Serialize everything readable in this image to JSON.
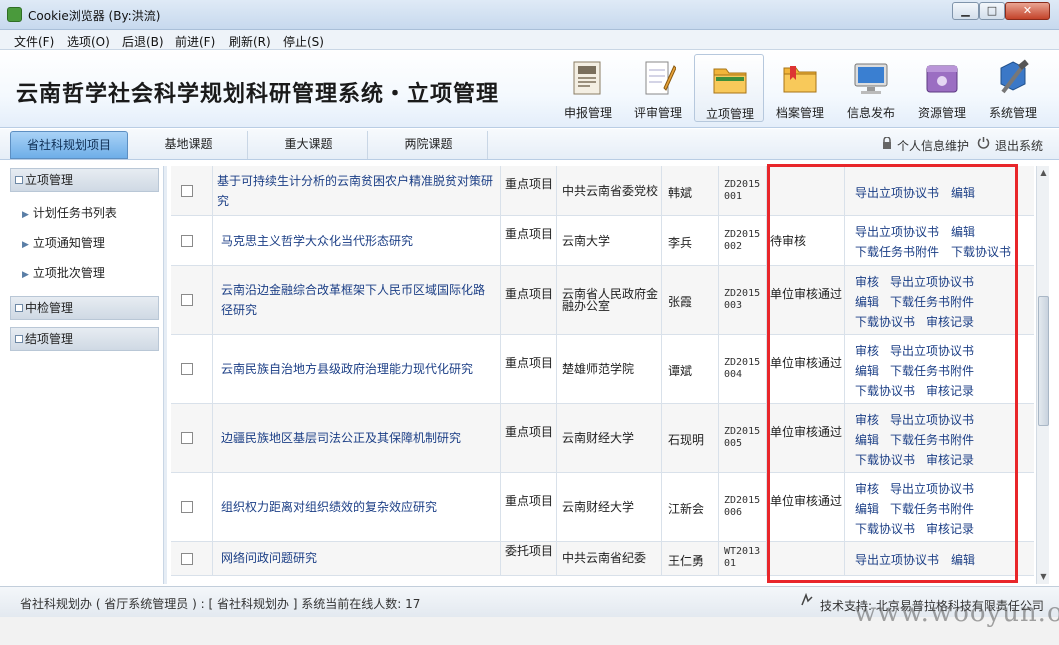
{
  "window": {
    "title": "Cookie浏览器 (By:洪流)",
    "minimize": "▁",
    "maximize": "□",
    "close": "✕"
  },
  "menu": [
    "文件(F)",
    "选项(O)",
    "后退(B)",
    "前进(F)",
    "刷新(R)",
    "停止(S)"
  ],
  "header": {
    "system_title": "云南哲学社会科学规划科研管理系统・立项管理",
    "nav": [
      {
        "label": "申报管理",
        "icon": "newspaper-icon",
        "active": false
      },
      {
        "label": "评审管理",
        "icon": "notepad-pencil-icon",
        "active": false
      },
      {
        "label": "立项管理",
        "icon": "folder-icon",
        "active": true
      },
      {
        "label": "档案管理",
        "icon": "folder-bookmark-icon",
        "active": false
      },
      {
        "label": "信息发布",
        "icon": "monitor-icon",
        "active": false
      },
      {
        "label": "资源管理",
        "icon": "purple-box-icon",
        "active": false
      },
      {
        "label": "系统管理",
        "icon": "tools-icon",
        "active": false
      }
    ]
  },
  "tabs": [
    {
      "label": "省社科规划项目",
      "active": true
    },
    {
      "label": "基地课题",
      "active": false
    },
    {
      "label": "重大课题",
      "active": false
    },
    {
      "label": "两院课题",
      "active": false
    }
  ],
  "user_links": {
    "profile": "个人信息维护",
    "logout": "退出系统"
  },
  "sidebar": {
    "groups": [
      {
        "label": "立项管理",
        "items": [
          "计划任务书列表",
          "立项通知管理",
          "立项批次管理"
        ]
      },
      {
        "label": "中检管理",
        "items": []
      },
      {
        "label": "结项管理",
        "items": []
      }
    ]
  },
  "table": {
    "rows": [
      {
        "title": "基于可持续生计分析的云南贫困农户精准脱贫对策研究",
        "type": "重点项目",
        "org": "中共云南省委党校",
        "person": "韩斌",
        "code": "ZD2015001",
        "status": "",
        "ops": [
          [
            "导出立项协议书",
            "编辑"
          ]
        ]
      },
      {
        "title": "马克思主义哲学大众化当代形态研究",
        "type": "重点项目",
        "org": "云南大学",
        "person": "李兵",
        "code": "ZD2015002",
        "status": "待审核",
        "ops": [
          [
            "导出立项协议书",
            "编辑"
          ],
          [
            "下载任务书附件",
            "下载协议书"
          ]
        ]
      },
      {
        "title": "云南沿边金融综合改革框架下人民币区域国际化路径研究",
        "type": "重点项目",
        "org": "云南省人民政府金融办公室",
        "person": "张霞",
        "code": "ZD2015003",
        "status": "单位审核通过",
        "ops": [
          [
            "审核",
            "导出立项协议书"
          ],
          [
            "编辑",
            "下载任务书附件"
          ],
          [
            "下载协议书",
            "审核记录"
          ]
        ]
      },
      {
        "title": "云南民族自治地方县级政府治理能力现代化研究",
        "type": "重点项目",
        "org": "楚雄师范学院",
        "person": "谭斌",
        "code": "ZD2015004",
        "status": "单位审核通过",
        "ops": [
          [
            "审核",
            "导出立项协议书"
          ],
          [
            "编辑",
            "下载任务书附件"
          ],
          [
            "下载协议书",
            "审核记录"
          ]
        ]
      },
      {
        "title": "边疆民族地区基层司法公正及其保障机制研究",
        "type": "重点项目",
        "org": "云南财经大学",
        "person": "石现明",
        "code": "ZD2015005",
        "status": "单位审核通过",
        "ops": [
          [
            "审核",
            "导出立项协议书"
          ],
          [
            "编辑",
            "下载任务书附件"
          ],
          [
            "下载协议书",
            "审核记录"
          ]
        ]
      },
      {
        "title": "组织权力距离对组织绩效的复杂效应研究",
        "type": "重点项目",
        "org": "云南财经大学",
        "person": "江新会",
        "code": "ZD2015006",
        "status": "单位审核通过",
        "ops": [
          [
            "审核",
            "导出立项协议书"
          ],
          [
            "编辑",
            "下载任务书附件"
          ],
          [
            "下载协议书",
            "审核记录"
          ]
        ]
      },
      {
        "title": "网络问政问题研究",
        "type": "委托项目",
        "org": "中共云南省纪委",
        "person": "王仁勇",
        "code": "WT201301",
        "status": "",
        "ops": [
          [
            "导出立项协议书",
            "编辑"
          ]
        ]
      }
    ]
  },
  "statusbar": {
    "left": "省社科规划办 ( 省厅系统管理员 ) : [ 省社科规划办 ]  系统当前在线人数: 17",
    "right": "技术支持: 北京易普拉格科技有限责任公司"
  },
  "watermark": "www.wooyun.org",
  "colors": {
    "highlight": "#e8262a",
    "link": "#1c3f86",
    "active_tab": "#6eaee8"
  }
}
